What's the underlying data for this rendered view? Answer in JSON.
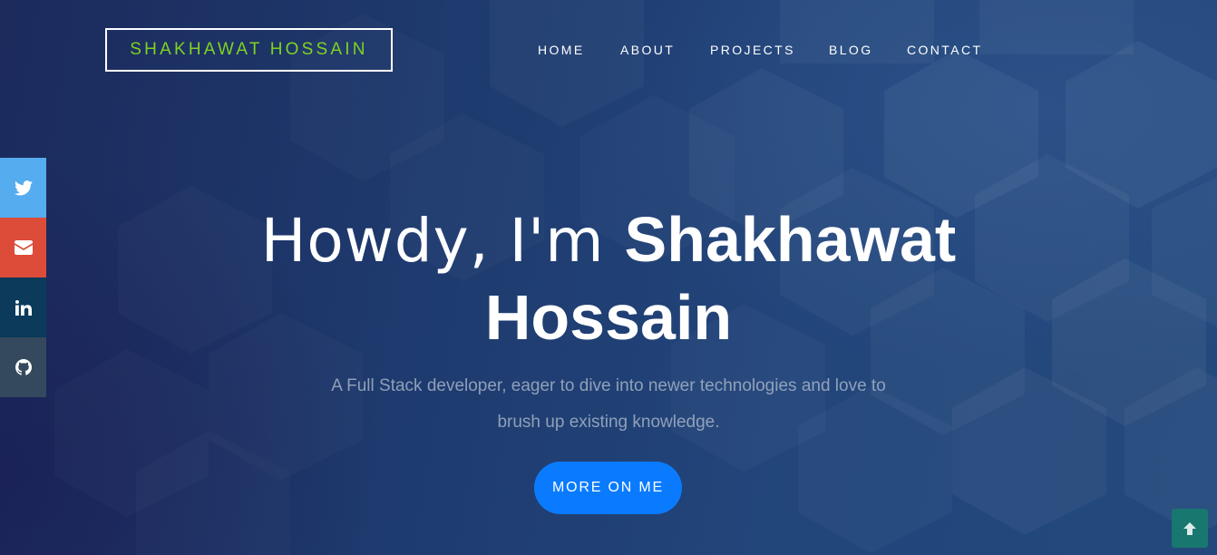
{
  "header": {
    "logo_text": "SHAKHAWAT HOSSAIN",
    "logo_color": "#7ed321"
  },
  "nav": {
    "items": [
      {
        "label": "HOME"
      },
      {
        "label": "ABOUT"
      },
      {
        "label": "PROJECTS"
      },
      {
        "label": "BLOG"
      },
      {
        "label": "CONTACT"
      }
    ]
  },
  "social": {
    "items": [
      {
        "icon": "twitter-icon",
        "color": "#55acee"
      },
      {
        "icon": "envelope-icon",
        "color": "#dd4b39"
      },
      {
        "icon": "linkedin-icon",
        "color": "#0b3a5b"
      },
      {
        "icon": "github-icon",
        "color": "#34495e"
      }
    ]
  },
  "hero": {
    "greeting": "Howdy, I'm ",
    "name_first": "Shakhawat",
    "name_last": "Hossain",
    "subtitle_line1": "A Full Stack developer, eager to dive into newer technologies and love to",
    "subtitle_line2": "brush up existing knowledge.",
    "cta_label": "MORE ON ME",
    "cta_color": "#0a7bff"
  },
  "scroll_top": {
    "icon": "arrow-up-icon",
    "color": "#18776f"
  }
}
